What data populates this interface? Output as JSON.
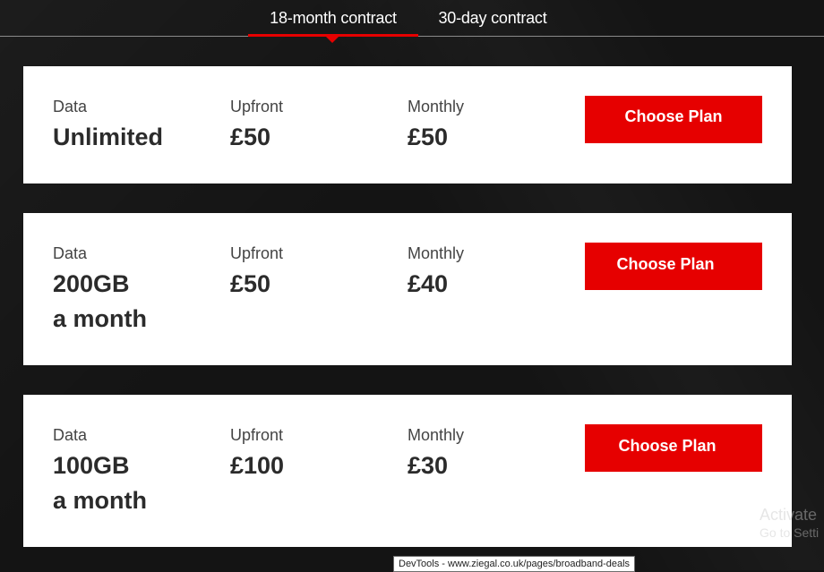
{
  "tabs": [
    {
      "label": "18-month contract",
      "active": true
    },
    {
      "label": "30-day contract",
      "active": false
    }
  ],
  "colors": {
    "accent": "#e60000",
    "background": "#141414",
    "card": "#ffffff"
  },
  "plans": [
    {
      "data_label": "Data",
      "data_value": "Unlimited",
      "data_value2": "",
      "upfront_label": "Upfront",
      "upfront_value": "£50",
      "monthly_label": "Monthly",
      "monthly_value": "£50",
      "button_label": "Choose Plan"
    },
    {
      "data_label": "Data",
      "data_value": "200GB",
      "data_value2": "a month",
      "upfront_label": "Upfront",
      "upfront_value": "£50",
      "monthly_label": "Monthly",
      "monthly_value": "£40",
      "button_label": "Choose Plan"
    },
    {
      "data_label": "Data",
      "data_value": "100GB",
      "data_value2": "a month",
      "upfront_label": "Upfront",
      "upfront_value": "£100",
      "monthly_label": "Monthly",
      "monthly_value": "£30",
      "button_label": "Choose Plan"
    }
  ],
  "watermark": {
    "line1": "Activate",
    "line2": "Go to Setti"
  },
  "status_tip": "DevTools - www.ziegal.co.uk/pages/broadband-deals"
}
